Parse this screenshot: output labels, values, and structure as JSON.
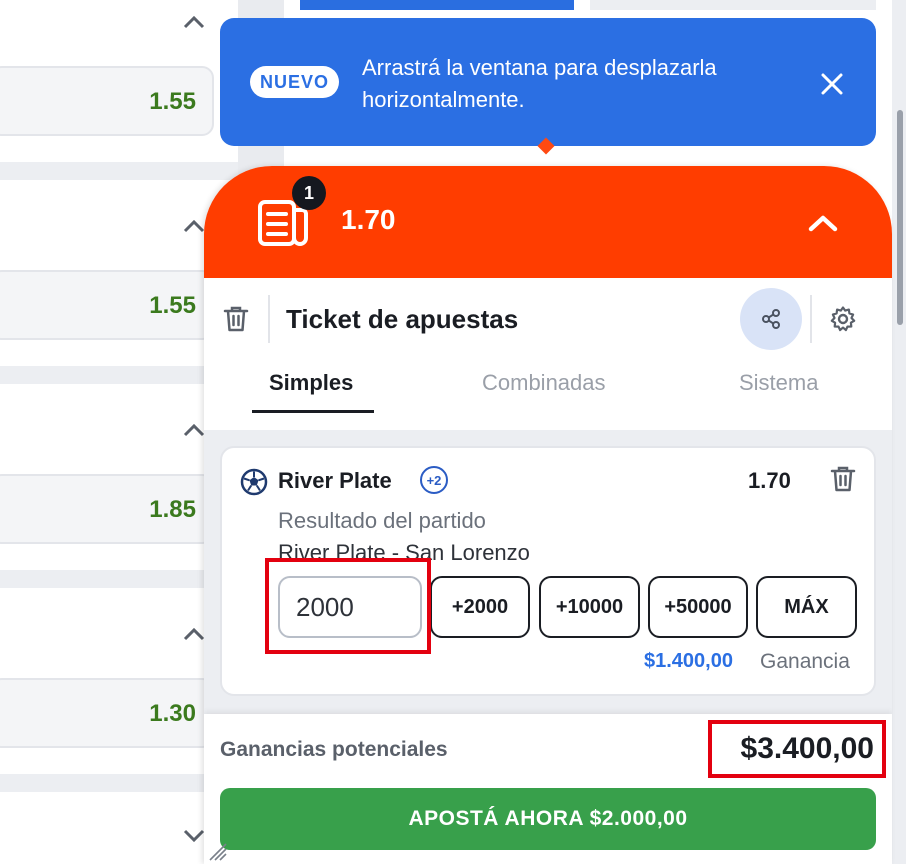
{
  "background": {
    "odds": [
      "1.55",
      "1.55",
      "1.85",
      "1.30"
    ]
  },
  "toast": {
    "badge": "NUEVO",
    "message": "Arrastrá la ventana para desplazarla horizontalmente."
  },
  "slip": {
    "count": "1",
    "total_odds": "1.70",
    "title": "Ticket de apuestas",
    "tabs": [
      "Simples",
      "Combinadas",
      "Sistema"
    ],
    "active_tab": "Simples",
    "selection": {
      "team": "River Plate",
      "extra": "+2",
      "odds": "1.70",
      "market": "Resultado del partido",
      "event": "River Plate - San Lorenzo",
      "stake": "2000",
      "quick_stakes": [
        "+2000",
        "+10000",
        "+50000",
        "MÁX"
      ],
      "gain_amount": "$1.400,00",
      "gain_label": "Ganancia"
    },
    "potential_label": "Ganancias potenciales",
    "potential_value": "$3.400,00",
    "cta": "APOSTÁ AHORA $2.000,00"
  },
  "colors": {
    "header": "#ff3d00",
    "toast": "#2b6fe3",
    "cta": "#38a04b",
    "odds": "#3b7a1e",
    "highlight": "#e3000f"
  }
}
